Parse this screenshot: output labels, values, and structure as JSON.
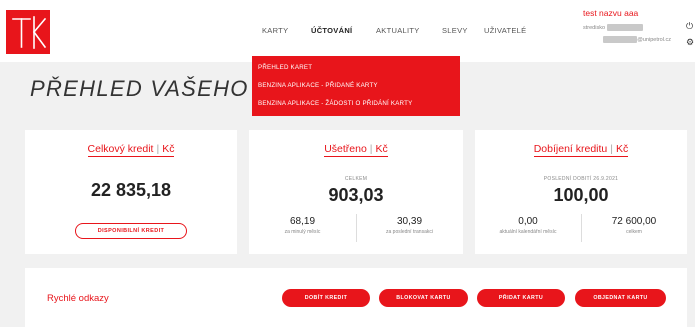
{
  "colors": {
    "brand_red": "#e8151b",
    "background": "#f1f1f1"
  },
  "header": {
    "nav": [
      {
        "label": "KARTY",
        "active": false
      },
      {
        "label": "ÚČTOVÁNÍ",
        "active": true
      },
      {
        "label": "AKTUALITY",
        "active": false
      },
      {
        "label": "SLEVY",
        "active": false
      },
      {
        "label": "UŽIVATELÉ",
        "active": false
      }
    ],
    "user": {
      "name": "test nazvu aaa",
      "line1_prefix": "stredisko",
      "line2_suffix": "@unipetrol.cz"
    },
    "side_icons": [
      "power-icon",
      "gear-icon"
    ]
  },
  "dropdown": {
    "items": [
      "PŘEHLED KARET",
      "BENZINA APLIKACE - PŘIDANÉ KARTY",
      "BENZINA APLIKACE - ŽÁDOSTI O PŘIDÁNÍ KARTY"
    ]
  },
  "page": {
    "title": "PŘEHLED VAŠEHO ÚČ"
  },
  "cards": {
    "credit": {
      "title": "Celkový kredit",
      "unit": "Kč",
      "value": "22 835,18",
      "button": "DISPONIBILNÍ KREDIT"
    },
    "saved": {
      "title": "Ušetřeno",
      "unit": "Kč",
      "caption": "CELKEM",
      "value": "903,03",
      "left_value": "68,19",
      "left_label": "za minulý měsíc",
      "right_value": "30,39",
      "right_label": "za poslední transakci"
    },
    "topup": {
      "title": "Dobíjení kreditu",
      "unit": "Kč",
      "caption": "POSLEDNÍ DOBITÍ 26.9.2021",
      "value": "100,00",
      "left_value": "0,00",
      "left_label": "aktuální kalendářní měsíc",
      "right_value": "72 600,00",
      "right_label": "celkem"
    }
  },
  "quick_links": {
    "label": "Rychlé odkazy",
    "buttons": [
      "DOBÍT KREDIT",
      "BLOKOVAT KARTU",
      "PŘIDAT KARTU",
      "OBJEDNAT KARTU"
    ]
  }
}
